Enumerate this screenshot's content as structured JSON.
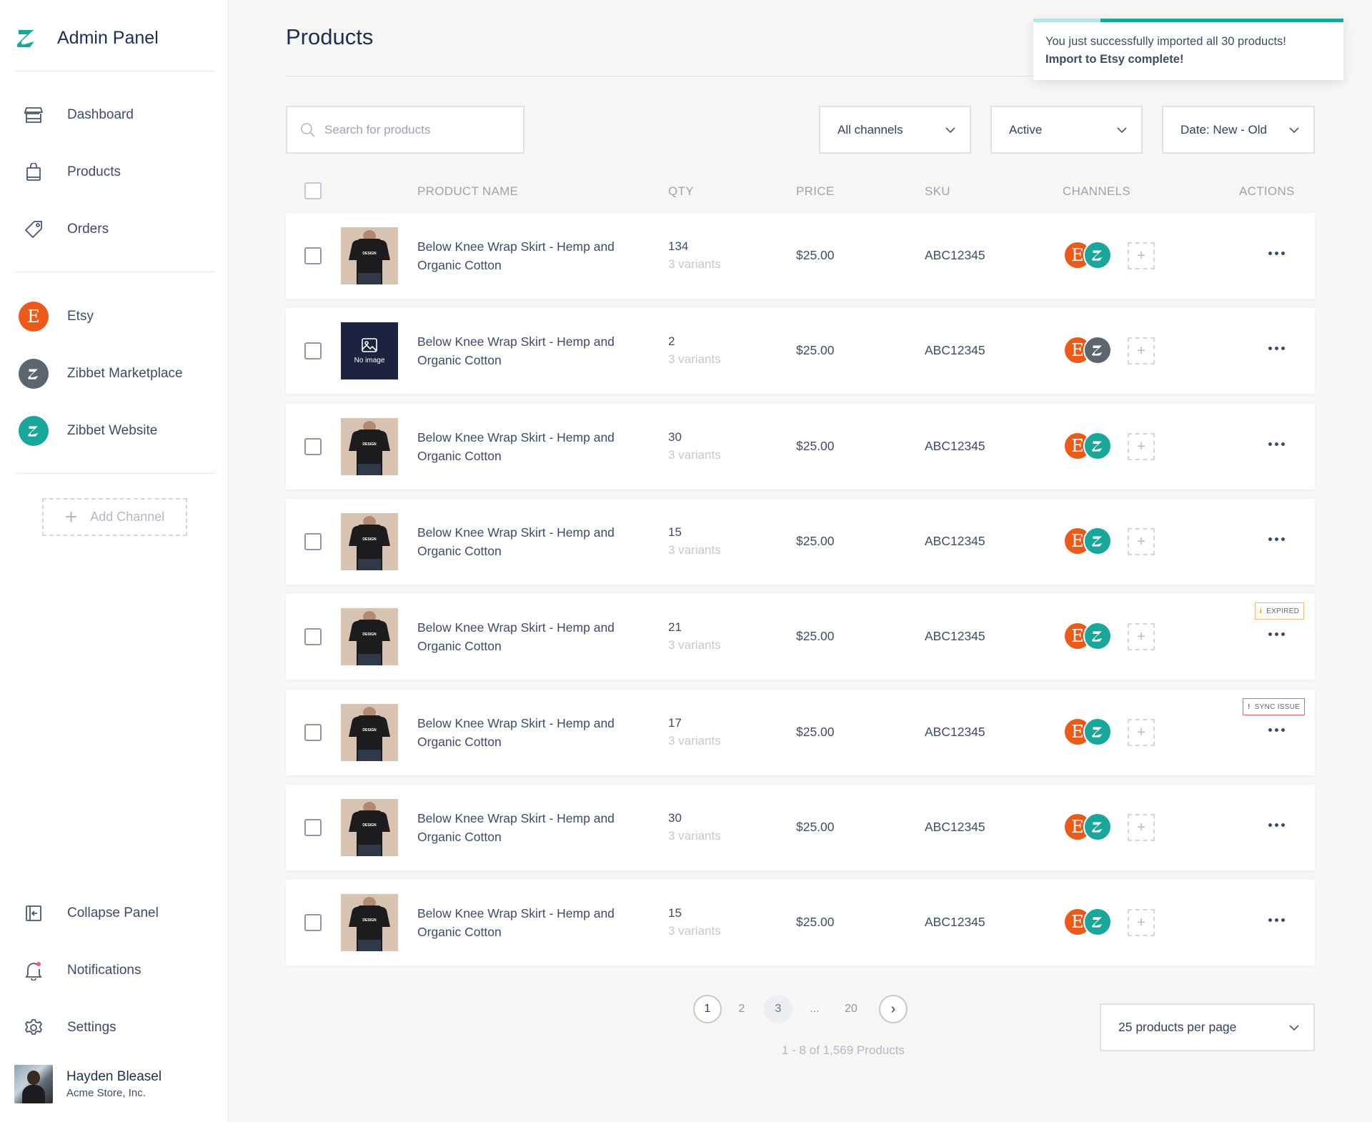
{
  "app": {
    "title": "Admin Panel"
  },
  "sidebar": {
    "nav": [
      {
        "label": "Dashboard",
        "icon": "store-icon"
      },
      {
        "label": "Products",
        "icon": "shopping-bag-icon"
      },
      {
        "label": "Orders",
        "icon": "tag-icon"
      }
    ],
    "channels": [
      {
        "label": "Etsy",
        "glyph": "E",
        "color": "#ea5a1b"
      },
      {
        "label": "Zibbet Marketplace",
        "color": "#5c6570"
      },
      {
        "label": "Zibbet Website",
        "color": "#1aa69b"
      }
    ],
    "add_channel": {
      "plus": "+",
      "label": "Add Channel"
    },
    "bottom": [
      {
        "label": "Collapse Panel",
        "icon": "collapse-panel-icon"
      },
      {
        "label": "Notifications",
        "icon": "bell-icon"
      },
      {
        "label": "Settings",
        "icon": "gear-icon"
      }
    ],
    "user": {
      "name": "Hayden Bleasel",
      "company": "Acme Store, Inc."
    }
  },
  "header": {
    "title": "Products"
  },
  "toast": {
    "message": "You just successfully imported all 30 products!",
    "strong": "Import to Etsy complete!"
  },
  "filters": {
    "search_placeholder": "Search for products",
    "channel": "All channels",
    "status": "Active",
    "sort": "Date: New - Old"
  },
  "table": {
    "columns": {
      "name": "PRODUCT NAME",
      "qty": "QTY",
      "price": "PRICE",
      "sku": "SKU",
      "channels": "CHANNELS",
      "actions": "ACTIONS"
    },
    "rows": [
      {
        "name": "Below Knee Wrap Skirt - Hemp and Organic Cotton",
        "qty": "134",
        "variants": "3 variants",
        "price": "$25.00",
        "sku": "ABC12345",
        "image": "tshirt",
        "second_channel": "teal",
        "badge": ""
      },
      {
        "name": "Below Knee Wrap Skirt - Hemp and Organic Cotton",
        "qty": "2",
        "variants": "3 variants",
        "price": "$25.00",
        "sku": "ABC12345",
        "image": "none",
        "no_image_label": "No image",
        "second_channel": "grey",
        "badge": ""
      },
      {
        "name": "Below Knee Wrap Skirt - Hemp and Organic Cotton",
        "qty": "30",
        "variants": "3 variants",
        "price": "$25.00",
        "sku": "ABC12345",
        "image": "tshirt",
        "second_channel": "teal",
        "badge": ""
      },
      {
        "name": "Below Knee Wrap Skirt - Hemp and Organic Cotton",
        "qty": "15",
        "variants": "3 variants",
        "price": "$25.00",
        "sku": "ABC12345",
        "image": "tshirt",
        "second_channel": "teal",
        "badge": ""
      },
      {
        "name": "Below Knee Wrap Skirt - Hemp and Organic Cotton",
        "qty": "21",
        "variants": "3 variants",
        "price": "$25.00",
        "sku": "ABC12345",
        "image": "tshirt",
        "second_channel": "teal",
        "badge": "EXPIRED",
        "badge_type": "exp"
      },
      {
        "name": "Below Knee Wrap Skirt - Hemp and Organic Cotton",
        "qty": "17",
        "variants": "3 variants",
        "price": "$25.00",
        "sku": "ABC12345",
        "image": "tshirt",
        "second_channel": "teal",
        "badge": "SYNC ISSUE",
        "badge_type": "sync"
      },
      {
        "name": "Below Knee Wrap Skirt - Hemp and Organic Cotton",
        "qty": "30",
        "variants": "3 variants",
        "price": "$25.00",
        "sku": "ABC12345",
        "image": "tshirt",
        "second_channel": "teal",
        "badge": ""
      },
      {
        "name": "Below Knee Wrap Skirt - Hemp and Organic Cotton",
        "qty": "15",
        "variants": "3 variants",
        "price": "$25.00",
        "sku": "ABC12345",
        "image": "tshirt",
        "second_channel": "teal",
        "badge": ""
      }
    ],
    "image_print": "DESIGN"
  },
  "pagination": {
    "pages": [
      "1",
      "2",
      "3",
      "...",
      "20"
    ],
    "current": "1",
    "next": "›",
    "summary": "1 - 8 of 1,569 Products",
    "per_page": "25 products per page"
  },
  "colors": {
    "accent": "#1aa69b",
    "etsy": "#ea5a1b",
    "text": "#3f4b66"
  }
}
